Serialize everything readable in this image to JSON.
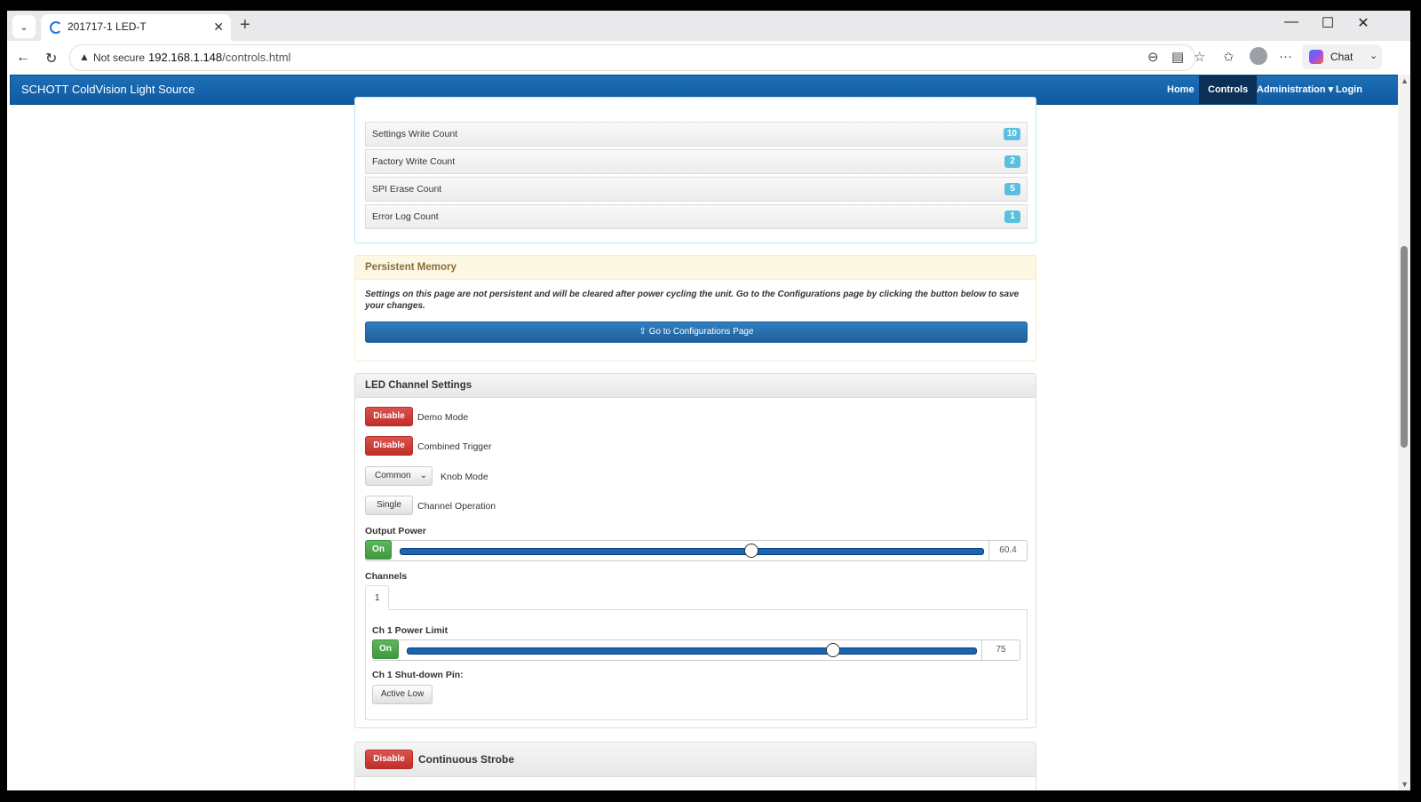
{
  "browser": {
    "tab_title": "201717-1 LED-T",
    "security_label": "Not secure",
    "url_host": "192.168.1.148",
    "url_path": "/controls.html",
    "chat_label": "Chat"
  },
  "app": {
    "brand": "SCHOTT ColdVision Light Source",
    "nav": [
      {
        "label": "Home",
        "active": false
      },
      {
        "label": "Controls",
        "active": true
      },
      {
        "label": "Administration ▾",
        "active": false
      },
      {
        "label": "Login",
        "active": false
      }
    ]
  },
  "counts": [
    {
      "label": "Settings Write Count",
      "value": "10"
    },
    {
      "label": "Factory Write Count",
      "value": "2"
    },
    {
      "label": "SPI Erase Count",
      "value": "5"
    },
    {
      "label": "Error Log Count",
      "value": "1"
    }
  ],
  "persistent": {
    "title": "Persistent Memory",
    "message": "Settings on this page are not persistent and will be cleared after power cycling the unit. Go to the Configurations page by clicking the button below to save your changes.",
    "button_label": "Go to Configurations Page"
  },
  "led": {
    "title": "LED Channel Settings",
    "demo_button": "Disable",
    "demo_label": "Demo Mode",
    "trigger_button": "Disable",
    "trigger_label": "Combined Trigger",
    "knob_select": "Common",
    "knob_label": "Knob Mode",
    "channel_op_button": "Single",
    "channel_op_label": "Channel Operation",
    "output_power_label": "Output Power",
    "output_power_toggle": "On",
    "output_power_value": "60.4",
    "channels_label": "Channels",
    "channel_tab": "1",
    "ch1_power_limit_label": "Ch 1 Power Limit",
    "ch1_power_toggle": "On",
    "ch1_power_value": "75",
    "ch1_shutdown_label": "Ch 1 Shut-down Pin:",
    "ch1_shutdown_button": "Active Low"
  },
  "strobe": {
    "button": "Disable",
    "title": "Continuous Strobe"
  },
  "sliders": {
    "output_power_fraction": 0.604,
    "ch1_power_fraction": 0.75
  },
  "colors": {
    "appbar": "#0f5aa3",
    "danger": "#d9534f",
    "success": "#5cb85c",
    "badge": "#5bc0de",
    "primary": "#1f5f9c"
  }
}
